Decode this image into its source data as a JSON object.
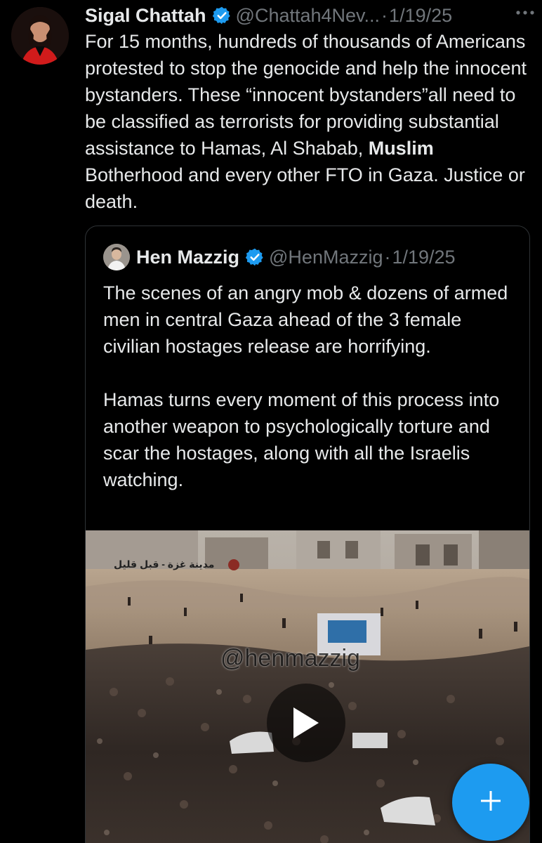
{
  "tweet": {
    "author_name": "Sigal Chattah",
    "handle": "@Chattah4Nev...",
    "separator": "·",
    "date": "1/19/25",
    "more_icon": "more-horizontal-icon",
    "text_before_bold": "For 15 months, hundreds of thousands of Americans protested to stop the genocide and help the innocent bystanders. These “innocent bystanders”all need to be classified as terrorists for providing substantial assistance to Hamas, Al Shabab, ",
    "text_bold": "Muslim",
    "text_after_bold": " Botherhood and every other FTO in Gaza. Justice or death."
  },
  "quote": {
    "author_name": "Hen Mazzig",
    "handle": "@HenMazzig",
    "separator": "·",
    "date": "1/19/25",
    "paragraph_1": "The scenes of an angry mob & dozens of armed men in central Gaza ahead of the 3 female civilian hostages release are horrifying.",
    "paragraph_2": "Hamas turns every moment of this process into another weapon to psychologically torture and scar the hostages, along with all the Israelis watching.",
    "video": {
      "watermark": "@henmazzig",
      "arabic_caption": "مدينة غزة - قبل قليل",
      "play_icon": "play-icon"
    }
  },
  "fab": {
    "icon": "plus-icon"
  },
  "colors": {
    "background": "#000000",
    "primary_text": "#e7e9ea",
    "secondary_text": "#71767b",
    "accent": "#1d9bf0",
    "border": "#2f3336"
  }
}
